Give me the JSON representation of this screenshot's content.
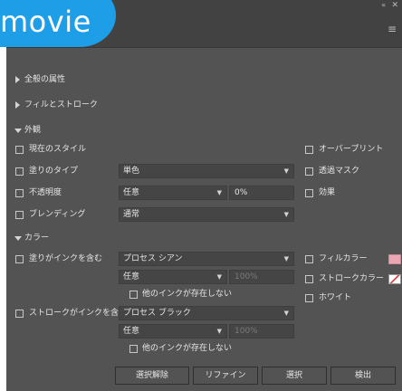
{
  "overlay": {
    "badge_text": "movie"
  },
  "panel": {
    "collapse_label": "«",
    "close_label": "✕",
    "menu_label": "≡",
    "colors": {
      "panel_bg": "#535353",
      "tab_bg": "#424242",
      "badge": "#1f9ee8",
      "fill_swatch": "#e8a7b2"
    }
  },
  "sections": {
    "general_attributes": "全般の属性",
    "fill_stroke": "フィルとストローク",
    "appearance": "外観",
    "color": "カラー"
  },
  "appearance": {
    "current_style": "現在のスタイル",
    "paint_type": {
      "label": "塗りのタイプ",
      "value": "単色"
    },
    "opacity": {
      "label": "不透明度",
      "value": "任意",
      "field": "0%"
    },
    "blending": {
      "label": "ブレンディング",
      "value": "通常"
    },
    "overprint": "オーバープリント",
    "transparency_mask": "透過マスク",
    "effects": "効果"
  },
  "color": {
    "fill_ink": {
      "label": "塗りがインクを含む",
      "ink": "プロセス シアン",
      "mode": "任意",
      "percent": "100%",
      "no_other": "他のインクが存在しない"
    },
    "stroke_ink": {
      "label": "ストロークがインクを含む",
      "ink": "プロセス ブラック",
      "mode": "任意",
      "percent": "100%",
      "no_other": "他のインクが存在しない"
    },
    "fill_color": "フィルカラー",
    "stroke_color": "ストロークカラー",
    "white": "ホワイト"
  },
  "buttons": {
    "deselect": "選択解除",
    "refine": "リファイン",
    "select": "選択",
    "detect": "検出"
  }
}
